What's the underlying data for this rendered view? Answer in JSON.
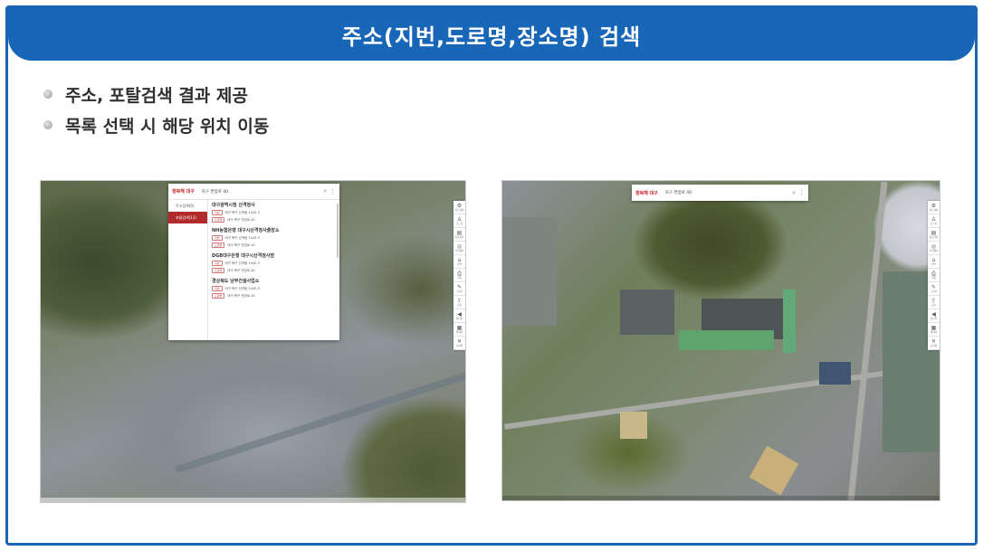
{
  "slide": {
    "title": "주소(지번,도로명,장소명) 검색",
    "bullets": [
      "주소, 포탈검색 결과 제공",
      "목록 선택 시 해당 위치 이동"
    ]
  },
  "left_map": {
    "logo": "행복해 대구",
    "search_query": "북구 연암로 40",
    "tabs": [
      {
        "label": "주소검색(0)",
        "active": false
      },
      {
        "label": "포털검색(13)",
        "active": true
      }
    ],
    "results": [
      {
        "name": "대구광역시청 산격청사",
        "jibun": "대구 북구 산격동 1445-3",
        "road": "대구 북구 연암로 40"
      },
      {
        "name": "NH농협은행 대구시산격청사출장소",
        "jibun": "대구 북구 산격동 1445-3",
        "road": "대구 북구 연암로 40"
      },
      {
        "name": "DGB대구은행 대구시산격청사점",
        "jibun": "대구 북구 산격동 1445-3",
        "road": "대구 북구 연암로 40"
      },
      {
        "name": "경상북도 남부건설사업소",
        "jibun": "대구 북구 산격동 1445-3",
        "road": "대구 북구 연암로 40"
      }
    ],
    "tag_jibun": "지번",
    "tag_road": "도로명"
  },
  "right_map": {
    "logo": "행복해 대구",
    "search_query": "북구 연암로 40"
  },
  "toolbar": {
    "buttons": [
      {
        "glyph": "⚙",
        "label": "지도설정"
      },
      {
        "glyph": "♙",
        "label": "로드뷰"
      },
      {
        "glyph": "▤",
        "label": "항공사진"
      },
      {
        "glyph": "◎",
        "label": "거리재기"
      },
      {
        "glyph": "⌂",
        "label": "면적"
      },
      {
        "glyph": "⎙",
        "label": "저장"
      },
      {
        "glyph": "✎",
        "label": "그리기"
      },
      {
        "glyph": "⇪",
        "label": "공유"
      },
      {
        "glyph": "◀",
        "label": "정보창"
      },
      {
        "glyph": "▦",
        "label": "레이어"
      },
      {
        "glyph": "✕",
        "label": "초기화"
      }
    ]
  },
  "colors": {
    "title_bar": "#1766b7",
    "frame": "#1f63b4",
    "active_tab": "#b32a2a",
    "logo": "#c9252c"
  }
}
